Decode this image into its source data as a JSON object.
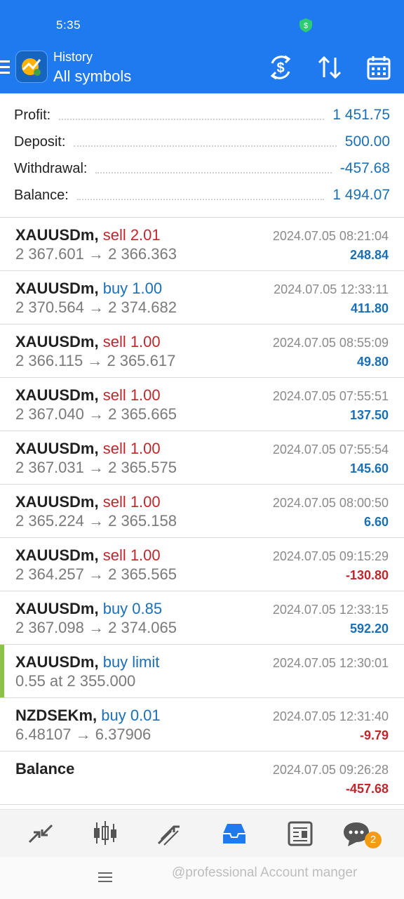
{
  "status": {
    "time": "5:35"
  },
  "header": {
    "subtitle": "History",
    "title": "All symbols"
  },
  "summary": {
    "profit_label": "Profit:",
    "profit_value": "1 451.75",
    "deposit_label": "Deposit:",
    "deposit_value": "500.00",
    "withdrawal_label": "Withdrawal:",
    "withdrawal_value": "-457.68",
    "balance_label": "Balance:",
    "balance_value": "1 494.07"
  },
  "deals": [
    {
      "symbol": "XAUUSDm,",
      "action": "sell 2.01",
      "prices": "2 367.601 → 2 366.363",
      "time": "2024.07.05 08:21:04",
      "profit": "248.84"
    },
    {
      "symbol": "XAUUSDm,",
      "action": "buy 1.00",
      "prices": "2 370.564 → 2 374.682",
      "time": "2024.07.05 12:33:11",
      "profit": "411.80"
    },
    {
      "symbol": "XAUUSDm,",
      "action": "sell 1.00",
      "prices": "2 366.115 → 2 365.617",
      "time": "2024.07.05 08:55:09",
      "profit": "49.80"
    },
    {
      "symbol": "XAUUSDm,",
      "action": "sell 1.00",
      "prices": "2 367.040 → 2 365.665",
      "time": "2024.07.05 07:55:51",
      "profit": "137.50"
    },
    {
      "symbol": "XAUUSDm,",
      "action": "sell 1.00",
      "prices": "2 367.031 → 2 365.575",
      "time": "2024.07.05 07:55:54",
      "profit": "145.60"
    },
    {
      "symbol": "XAUUSDm,",
      "action": "sell 1.00",
      "prices": "2 365.224 → 2 365.158",
      "time": "2024.07.05 08:00:50",
      "profit": "6.60"
    },
    {
      "symbol": "XAUUSDm,",
      "action": "sell 1.00",
      "prices": "2 364.257 → 2 365.565",
      "time": "2024.07.05 09:15:29",
      "profit": "-130.80"
    },
    {
      "symbol": "XAUUSDm,",
      "action": "buy 0.85",
      "prices": "2 367.098 → 2 374.065",
      "time": "2024.07.05 12:33:15",
      "profit": "592.20"
    },
    {
      "symbol": "XAUUSDm,",
      "action": "buy limit",
      "prices": "0.55 at 2 355.000",
      "time": "2024.07.05 12:30:01",
      "profit": ""
    },
    {
      "symbol": "NZDSEKm,",
      "action": "buy 0.01",
      "prices": "6.48107 → 6.37906",
      "time": "2024.07.05 12:31:40",
      "profit": "-9.79"
    },
    {
      "symbol": "Balance",
      "action": "",
      "prices": "",
      "time": "2024.07.05 09:26:28",
      "profit": "-457.68"
    }
  ],
  "nav": {
    "chat_badge": "2"
  },
  "watermark": "@professional Account manger",
  "colors": {
    "primary": "#1f7af0",
    "sell": "#c0272d",
    "buy": "#1a6fb6",
    "pending": "#8bc34a",
    "badge": "#f39c12"
  },
  "icons": [
    "menu-icon",
    "app-logo-icon",
    "currency-exchange-icon",
    "sort-icon",
    "calendar-icon",
    "quotes-icon",
    "chart-icon",
    "trade-icon",
    "history-icon",
    "news-icon",
    "chat-icon"
  ]
}
